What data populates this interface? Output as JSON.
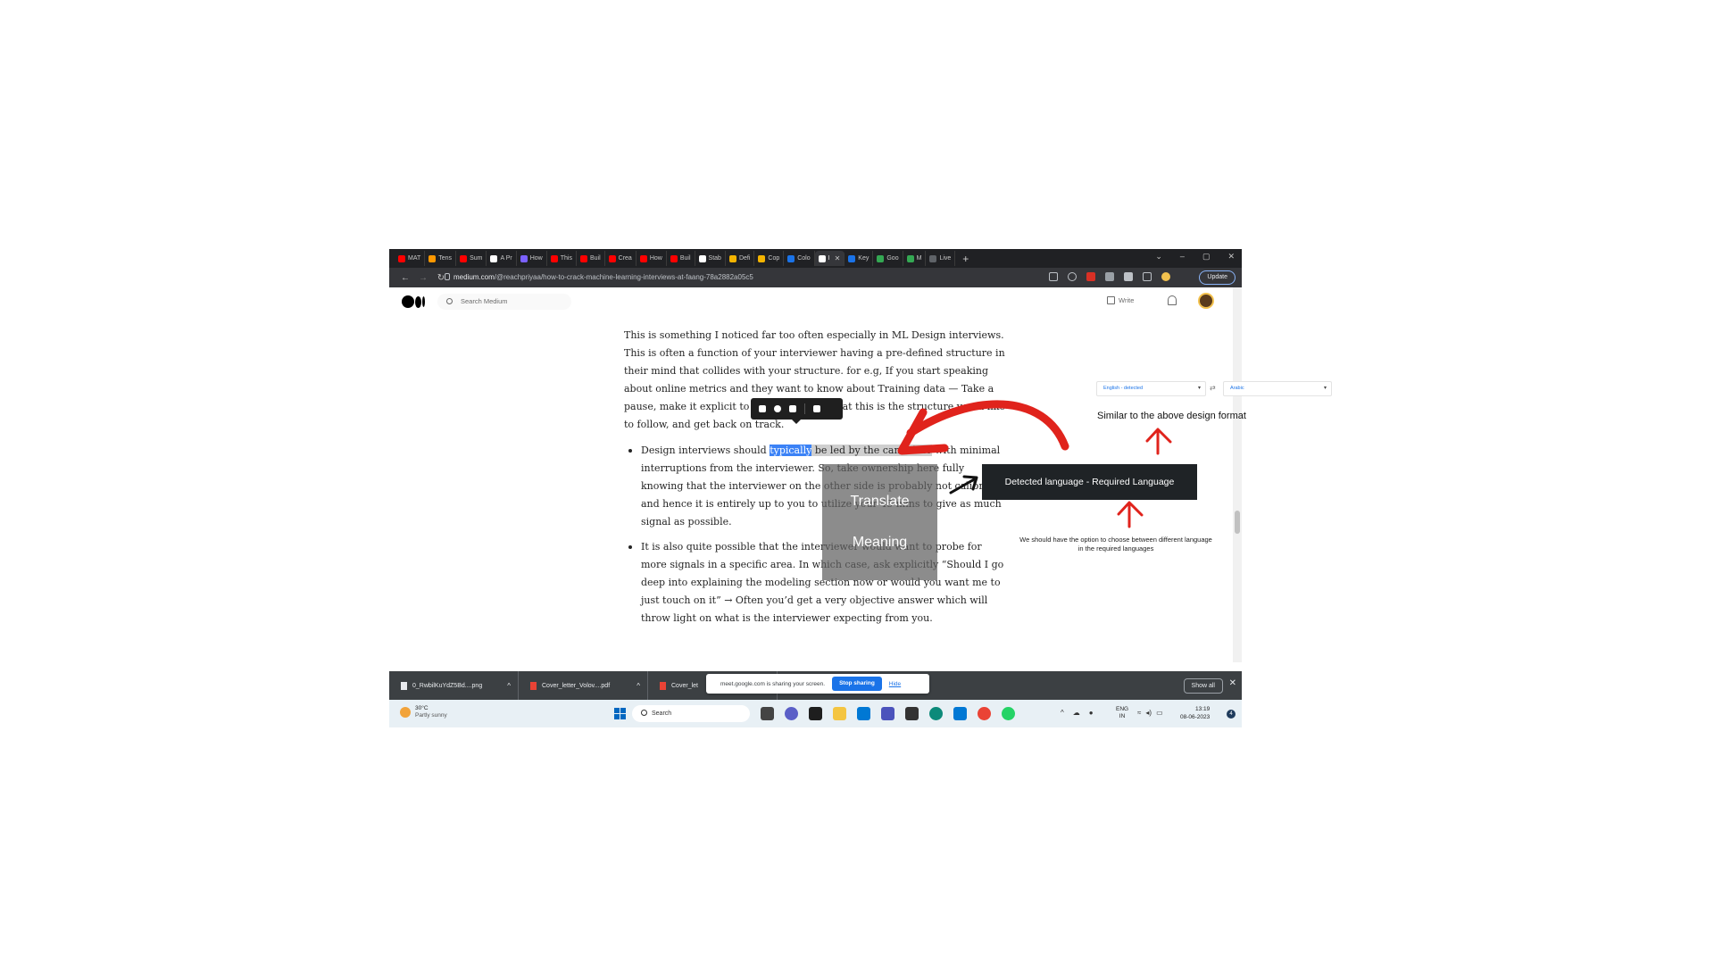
{
  "browser": {
    "tabs": [
      {
        "label": "MAT",
        "color": "#ff0000"
      },
      {
        "label": "Tens",
        "color": "#ff9800"
      },
      {
        "label": "Sum",
        "color": "#ff0000"
      },
      {
        "label": "A Pr",
        "color": "#ffffff"
      },
      {
        "label": "How",
        "color": "#7b61ff"
      },
      {
        "label": "This",
        "color": "#ff0000"
      },
      {
        "label": "Buil",
        "color": "#ff0000"
      },
      {
        "label": "Crea",
        "color": "#ff0000"
      },
      {
        "label": "How",
        "color": "#ff0000"
      },
      {
        "label": "Buil",
        "color": "#ff0000"
      },
      {
        "label": "Stab",
        "color": "#ffffff"
      },
      {
        "label": "Defi",
        "color": "#f4b400"
      },
      {
        "label": "Cop",
        "color": "#f4b400"
      },
      {
        "label": "Colo",
        "color": "#1a73e8"
      },
      {
        "label": "I",
        "color": "#ffffff",
        "active": true
      },
      {
        "label": "Key",
        "color": "#1a73e8"
      },
      {
        "label": "Goo",
        "color": "#34a853"
      },
      {
        "label": "M",
        "color": "#34a853"
      },
      {
        "label": "Live",
        "color": "#5f6368"
      }
    ],
    "new_tab": "+",
    "url_domain": "medium.com",
    "url_path": "/@reachpriyaa/how-to-crack-machine-learning-interviews-at-faang-78a2882a05c5",
    "update_label": "Update",
    "window_controls": [
      "⌄",
      "–",
      "▢",
      "✕"
    ]
  },
  "medium": {
    "search_placeholder": "Search Medium",
    "write_label": "Write"
  },
  "article": {
    "para1": "This is something I noticed far too often especially in ML Design interviews. This is often a function of your interviewer having a pre-defined structure in their mind that collides with your structure. for e.g, If you start speaking about online metrics and they want to know about Training data — Take a pause, make it explicit to the interviewer that this is the structure you’d like to follow, and get back on track.",
    "bullet1_pre": "Design interviews should ",
    "bullet1_hl": "typically",
    "bullet1_sel": " be led by the candidate",
    "bullet1_post": " with minimal interruptions from the interviewer. So, take ownership here fully knowing that the interviewer on the other side is probably not calibrated and hence it is entirely up to you to utilize your 45 mins to give as much signal as possible.",
    "bullet2": "It is also quite possible that the interviewer would want to probe for more signals in a specific area. In which case, ask explicitly “Should I go deep into explaining the modeling section now or would you want me to just touch on it” → Often you’d get a very objective answer which will throw light on what is the interviewer expecting from you."
  },
  "downloads": {
    "items": [
      {
        "name": "0_RwbilKuYdZ5Bd....png"
      },
      {
        "name": "Cover_letter_Volov....pdf"
      },
      {
        "name": "Cover_let"
      }
    ],
    "show_all": "Show all",
    "close": "✕",
    "share_text": "meet.google.com is sharing your screen.",
    "stop_sharing": "Stop sharing",
    "hide": "Hide"
  },
  "taskbar": {
    "temp": "30°C",
    "weather": "Partly sunny",
    "search_label": "Search",
    "lang_top": "ENG",
    "lang_bottom": "IN",
    "time": "13:19",
    "date": "08-06-2023",
    "notif_count": "4"
  },
  "annotations": {
    "translate": "Translate",
    "meaning": "Meaning",
    "detected_required": "Detected language  - Required Language",
    "similar_note": "Similar to the above design format",
    "option_note": "We should have the option to choose between different language in the required languages",
    "dropdown_source": "English - detected",
    "dropdown_target": "Arabic",
    "annotation_color": "#e0231c"
  }
}
